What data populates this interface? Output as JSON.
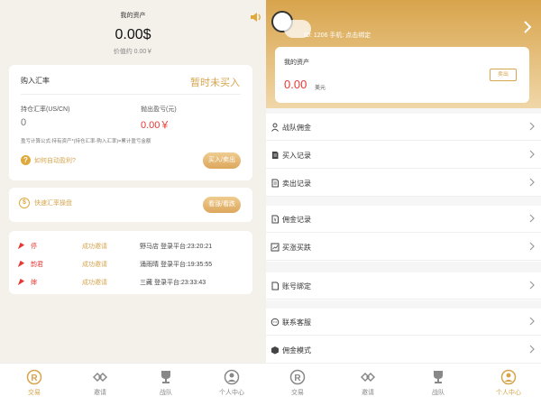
{
  "left": {
    "assets": {
      "title": "我的资产",
      "amount": "0.00$",
      "sub": "价值约 0.00￥"
    },
    "rate_card": {
      "title": "购入汇率",
      "status": "暂时未买入",
      "holding_label": "持仓汇率(US/CN)",
      "holding_value": "0",
      "sell_label": "抛出盈亏(元)",
      "sell_value": "0.00￥",
      "formula": "盈亏计算公式:持有资产*(持仓汇率-购入汇率)=累计盈亏金额",
      "howto": "如何自动盈利?",
      "buy_sell_button": "买入/卖出"
    },
    "quick_card": {
      "label": "快速汇率操盘",
      "button": "看涨/看跌"
    },
    "feed": [
      {
        "name": "停",
        "status": "成功邀请",
        "login": "野马店 登录平台:23:20:21"
      },
      {
        "name": "韵君",
        "status": "成功邀请",
        "login": "涌雨晴 登录平台:19:35:55"
      },
      {
        "name": "婶",
        "status": "成功邀请",
        "login": "三藏 登录平台:23:33:43"
      }
    ],
    "tabs": [
      {
        "label": "交易",
        "icon": "trade-icon",
        "active": true
      },
      {
        "label": "邀请",
        "icon": "invite-icon",
        "active": false
      },
      {
        "label": "战队",
        "icon": "trophy-icon",
        "active": false
      },
      {
        "label": "个人中心",
        "icon": "user-icon",
        "active": false
      }
    ]
  },
  "right": {
    "header": {
      "id_text": "ID: 1206 手机: 点击绑定"
    },
    "assets": {
      "title": "我的资产",
      "amount": "0.00",
      "unit": "美元",
      "sell_button": "卖出"
    },
    "menu": [
      {
        "label": "战队佣金",
        "icon": "user-icon"
      },
      {
        "label": "买入记录",
        "icon": "document-icon"
      },
      {
        "label": "卖出记录",
        "icon": "document-icon"
      },
      {
        "label": "佣金记录",
        "icon": "document-icon"
      },
      {
        "label": "买涨买跌",
        "icon": "chart-icon"
      },
      {
        "label": "账号绑定",
        "icon": "document-icon"
      },
      {
        "label": "联系客服",
        "icon": "chat-icon"
      },
      {
        "label": "佣金模式",
        "icon": "cube-icon"
      }
    ],
    "tabs": [
      {
        "label": "交易",
        "icon": "trade-icon",
        "active": false
      },
      {
        "label": "邀请",
        "icon": "invite-icon",
        "active": false
      },
      {
        "label": "战队",
        "icon": "trophy-icon",
        "active": false
      },
      {
        "label": "个人中心",
        "icon": "user-icon",
        "active": true
      }
    ]
  },
  "colors": {
    "accent": "#d6a54e",
    "profit": "#e53935",
    "background": "#f4f0ea"
  }
}
